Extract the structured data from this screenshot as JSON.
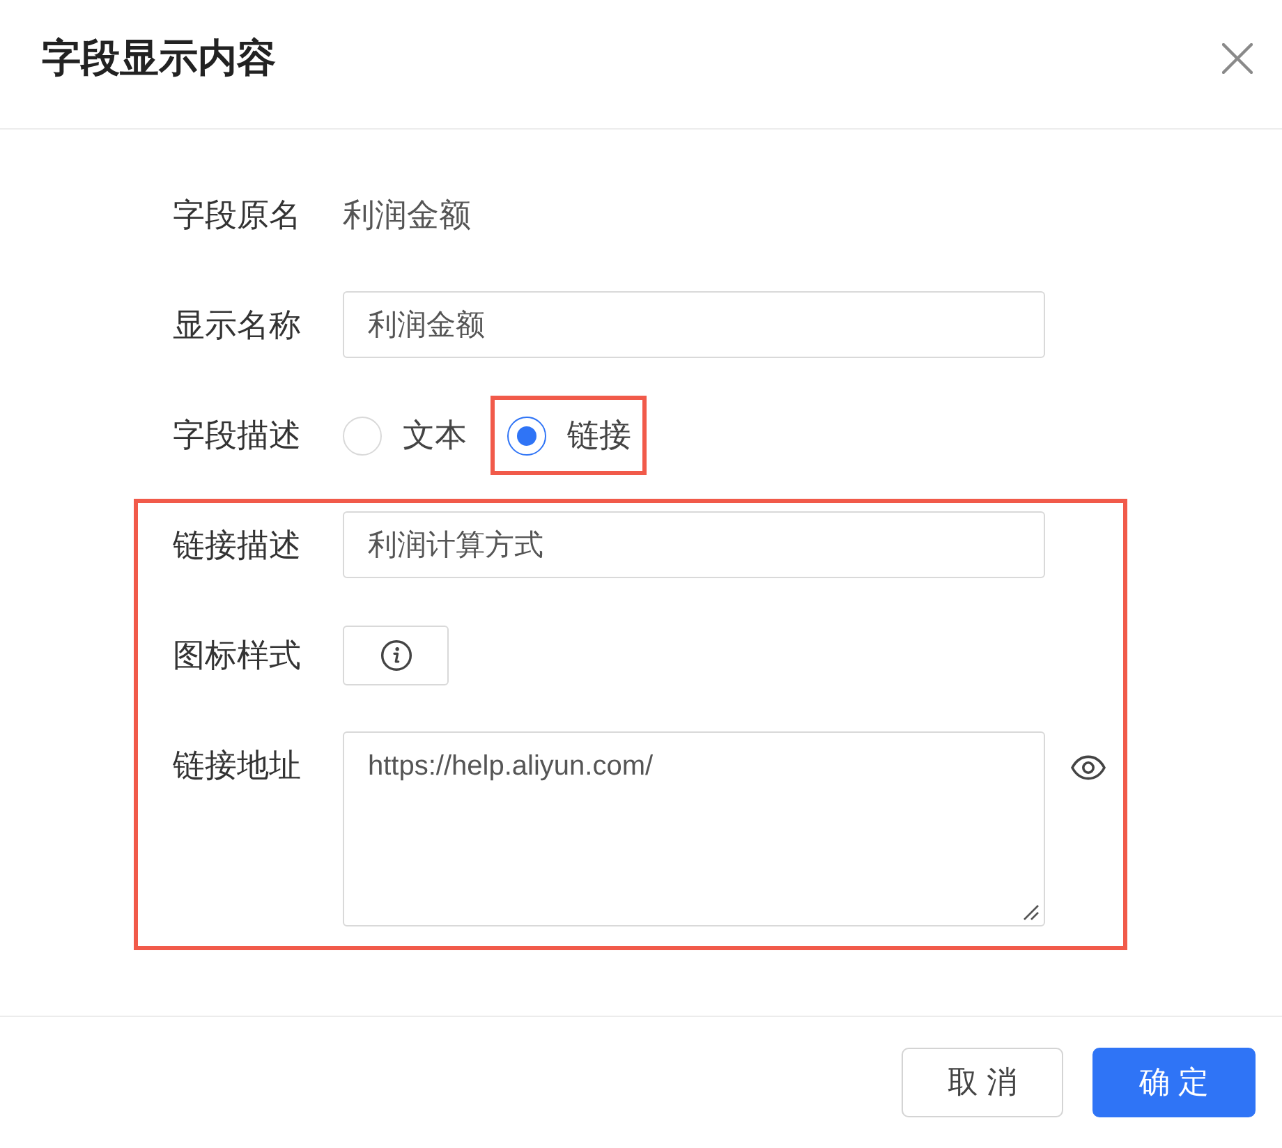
{
  "dialog": {
    "title": "字段显示内容"
  },
  "form": {
    "original_name": {
      "label": "字段原名",
      "value": "利润金额"
    },
    "display_name": {
      "label": "显示名称",
      "value": "利润金额"
    },
    "description": {
      "label": "字段描述",
      "options": [
        {
          "label": "文本",
          "selected": false,
          "highlighted": false
        },
        {
          "label": "链接",
          "selected": true,
          "highlighted": true
        }
      ]
    },
    "link_section": {
      "highlighted": true,
      "link_description": {
        "label": "链接描述",
        "value": "利润计算方式"
      },
      "icon_style": {
        "label": "图标样式"
      },
      "link_address": {
        "label": "链接地址",
        "value": "https://help.aliyun.com/"
      }
    }
  },
  "footer": {
    "buttons": [
      {
        "label": "取 消",
        "kind": "secondary"
      },
      {
        "label": "确 定",
        "kind": "primary"
      }
    ]
  }
}
